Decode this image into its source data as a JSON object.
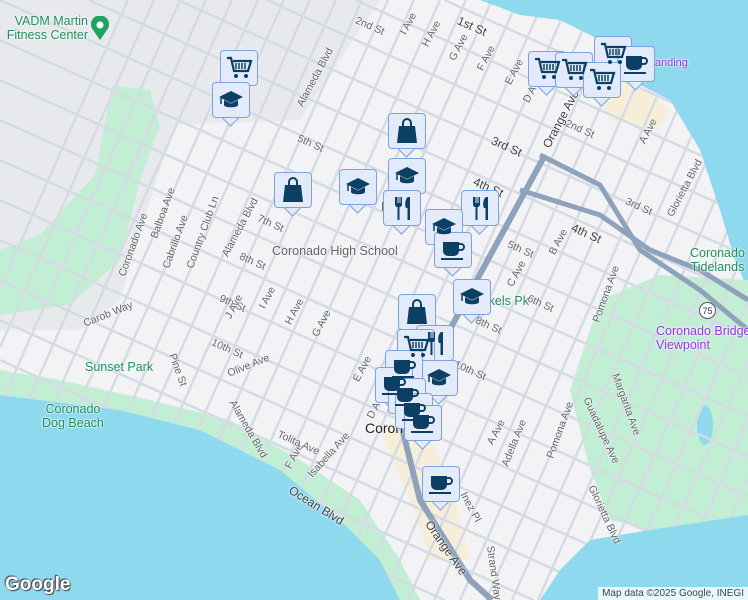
{
  "colors": {
    "water": "#8fd9ee",
    "park": "#c2eed4",
    "base": "#f3f2f4",
    "military": "#e8e9ec",
    "highway": "#8ea3bb",
    "marker_fill": "#e3ebfb",
    "marker_border": "#7da2e0",
    "marker_icon": "#0b3f63"
  },
  "pois": {
    "fitness": "VADM Martin\nFitness Center",
    "high_school": "Coronado High School",
    "park_sk": "Spreckels Pk",
    "sunset_park": "Sunset Park",
    "dog_beach": "Coronado\nDog Beach",
    "tidelands": "Coronado\nTidelands",
    "bridge_view": "Coronado Bridge\nViewpoint",
    "ferry": "Ferry Landing",
    "city": "Coronado",
    "b_label": "B"
  },
  "streets": {
    "alameda1": "Alameda Blvd",
    "alameda2": "Alameda Blvd",
    "alameda3": "Alameda Blvd",
    "st1": "1st St",
    "st2": "2nd St",
    "st2b": "2nd St",
    "st3": "3rd St",
    "st3b": "3rd St",
    "st4": "4th St",
    "st4b": "4th St",
    "st5": "5th St",
    "st5b": "5th St",
    "st6": "6th St",
    "st7": "7th St",
    "st8": "8th St",
    "st9": "9th St",
    "st10": "10th St",
    "st8b": "8th St",
    "st10b": "10th St",
    "iave": "I Ave",
    "have": "H Ave",
    "gave": "G Ave",
    "fave": "F Ave",
    "eave": "E Ave",
    "dave": "D Ave",
    "cave": "C Ave",
    "bave": "B Ave",
    "aave": "A Ave",
    "aave2": "A Ave",
    "orange": "Orange Ave",
    "orange2": "Orange Ave",
    "jave": "J Ave",
    "iave2": "I Ave",
    "have2": "H Ave",
    "gave2": "G Ave",
    "eave2": "E Ave",
    "dave2": "D Ave",
    "fave2": "F Ave",
    "coronado": "Coronado Ave",
    "balboa": "Balboa Ave",
    "cabrillo": "Cabrillo Ave",
    "country": "Country Club Ln",
    "carob": "Carob Way",
    "pine": "Pine St",
    "olive": "Olive Ave",
    "tolita": "Tolita Ave",
    "isabella": "Isabella Ave",
    "ocean": "Ocean Blvd",
    "pomona": "Pomona Ave",
    "pomona2": "Pomona Ave",
    "margarita": "Margarita Ave",
    "guadalupe": "Guadalupe Ave",
    "glorietta": "Glorietta Blvd",
    "glorietta2": "Glorietta Blvd",
    "adella": "Adella Ave",
    "inez": "Inez Pl",
    "strand": "Strand Way"
  },
  "highway_shield": "75",
  "markers": [
    "cart",
    "grad",
    "bag",
    "grad",
    "bag",
    "grad",
    "fork",
    "fork",
    "grad",
    "cup",
    "grad",
    "bag",
    "fork",
    "cart",
    "cup",
    "cup",
    "cup",
    "cup",
    "cup",
    "grad",
    "cart",
    "cart",
    "cart",
    "cart",
    "cup"
  ],
  "google_logo": "Google",
  "attribution": "Map data ©2025 Google, INEGI"
}
